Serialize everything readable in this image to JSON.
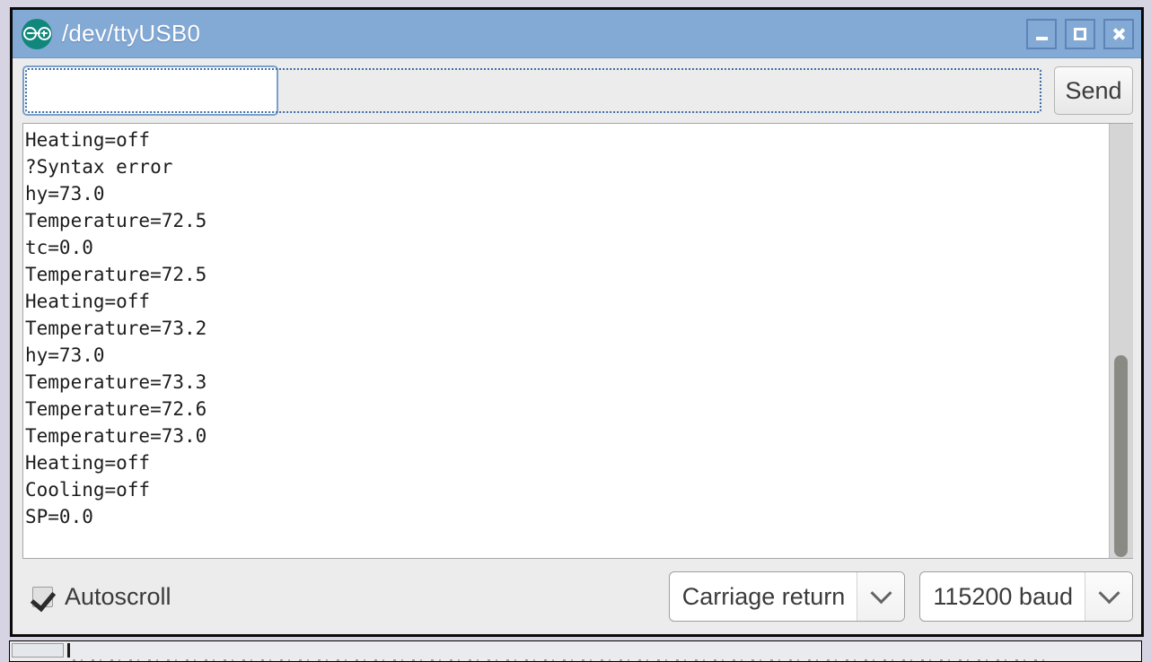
{
  "window": {
    "title": "/dev/ttyUSB0",
    "app_icon": "arduino-logo-icon",
    "controls": {
      "minimize_label": "–",
      "maximize_label": "□",
      "close_label": "✕"
    }
  },
  "send_row": {
    "input_value": "",
    "input_placeholder": "",
    "send_label": "Send"
  },
  "console": {
    "lines": [
      "Heating=off",
      "?Syntax error",
      "hy=73.0",
      "Temperature=72.5",
      "tc=0.0",
      "Temperature=72.5",
      "Heating=off",
      "Temperature=73.2",
      "hy=73.0",
      "Temperature=73.3",
      "Temperature=72.6",
      "Temperature=73.0",
      "Heating=off",
      "Cooling=off",
      "SP=0.0"
    ],
    "text": "Heating=off\n?Syntax error\nhy=73.0\nTemperature=72.5\ntc=0.0\nTemperature=72.5\nHeating=off\nTemperature=73.2\nhy=73.0\nTemperature=73.3\nTemperature=72.6\nTemperature=73.0\nHeating=off\nCooling=off\nSP=0.0",
    "scrollbar": {
      "orientation": "vertical",
      "thumb_present": true
    }
  },
  "bottom_bar": {
    "autoscroll_label": "Autoscroll",
    "autoscroll_checked": true,
    "line_ending": {
      "selected": "Carriage return",
      "arrow_icon": "chevron-down-icon"
    },
    "baud_rate": {
      "selected": "115200 baud",
      "arrow_icon": "chevron-down-icon"
    }
  },
  "colors": {
    "titlebar": "#83a9d5",
    "desktop": "#d6d3e2",
    "chrome": "#ececec",
    "console_bg": "#ffffff",
    "console_text": "#1d1d1d",
    "arduino_teal": "#11877c",
    "focus_border": "#7aa0cc"
  }
}
